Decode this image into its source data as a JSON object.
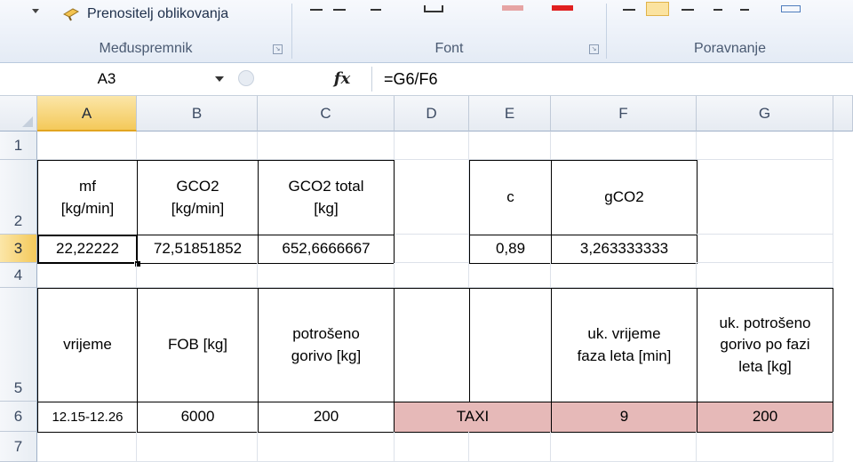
{
  "ribbon": {
    "format_painter_label": "Prenositelj oblikovanja",
    "groups": {
      "clipboard": "Međuspremnik",
      "font": "Font",
      "alignment": "Poravnanje"
    }
  },
  "formula_bar": {
    "name_box": "A3",
    "fx_label": "fx",
    "formula": "=G6/F6"
  },
  "columns": [
    "A",
    "B",
    "C",
    "D",
    "E",
    "F",
    "G"
  ],
  "rows": [
    "1",
    "2",
    "3",
    "4",
    "5",
    "6",
    "7"
  ],
  "cells": {
    "A2": "mf\n[kg/min]",
    "B2": "GCO2\n[kg/min]",
    "C2": "GCO2 total\n[kg]",
    "E2": "c",
    "F2": "gCO2",
    "A3": "22,22222",
    "B3": "72,51851852",
    "C3": "652,6666667",
    "E3": "0,89",
    "F3": "3,263333333",
    "A5": "vrijeme",
    "B5": "FOB [kg]",
    "C5": "potrošeno\ngorivo [kg]",
    "F5": "uk. vrijeme\nfaza leta [min]",
    "G5": "uk. potrošeno\ngorivo po fazi\nleta [kg]",
    "A6": "12.15-12.26",
    "B6": "6000",
    "C6": "200",
    "D6": "TAXI",
    "F6": "9",
    "G6": "200"
  },
  "colors": {
    "highlight_fill": "#e6b9b8",
    "active_header": "#f4c95a"
  }
}
